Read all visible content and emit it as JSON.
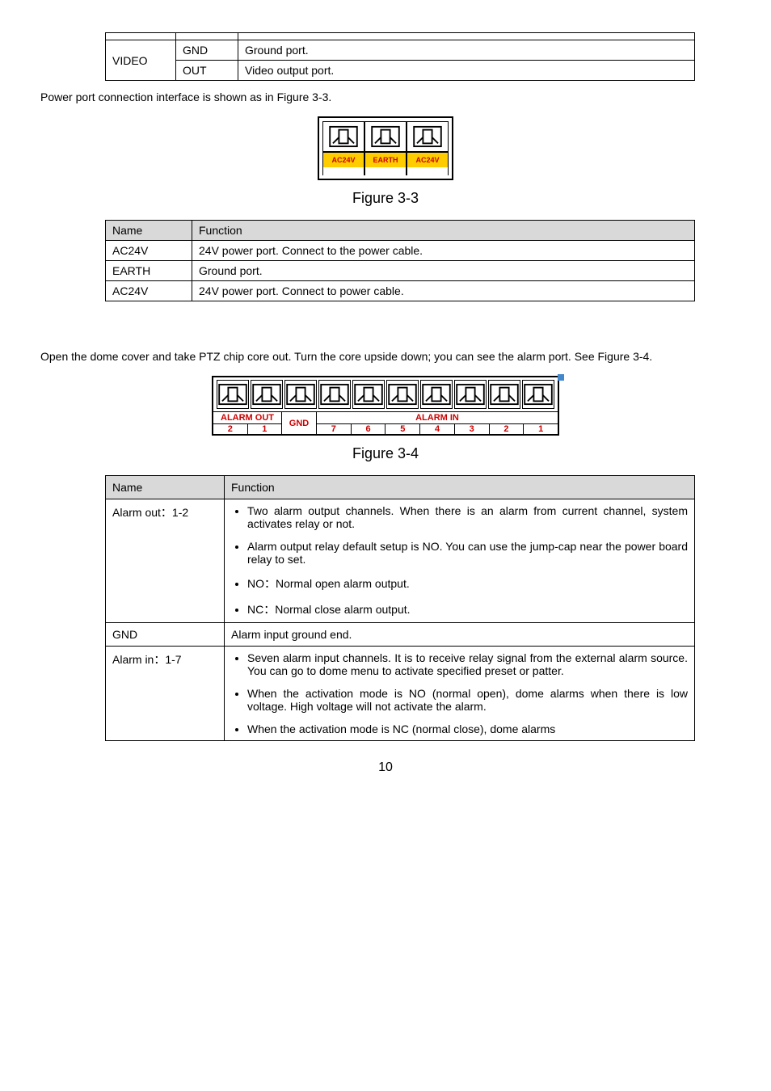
{
  "port_table": {
    "rows": [
      {
        "c1": "VIDEO",
        "c2": "GND",
        "c3": "Ground port."
      },
      {
        "c1": "",
        "c2": "OUT",
        "c3": "Video output port."
      }
    ]
  },
  "text_power_intro": "Power port connection interface is shown as in Figure 3-3.",
  "power_labels": [
    "AC24V",
    "EARTH",
    "AC24V"
  ],
  "figure_3_3": "Figure 3-3",
  "func_table_1": {
    "header": {
      "name": "Name",
      "func": "Function"
    },
    "rows": [
      {
        "name": "AC24V",
        "func": "24V power port. Connect to the power cable."
      },
      {
        "name": "EARTH",
        "func": "Ground port."
      },
      {
        "name": "AC24V",
        "func": "24V power port. Connect to power cable."
      }
    ]
  },
  "text_open_dome": "Open the dome cover and take PTZ chip core out. Turn the core upside down; you can see the alarm port. See Figure 3-4.",
  "alarm": {
    "out_label": "ALARM OUT",
    "out_nums": [
      "2",
      "1"
    ],
    "gnd": "GND",
    "in_label": "ALARM IN",
    "in_nums": [
      "7",
      "6",
      "5",
      "4",
      "3",
      "2",
      "1"
    ]
  },
  "figure_3_4": "Figure 3-4",
  "func_table_2": {
    "header": {
      "name": "Name",
      "func": "Function"
    },
    "rows": {
      "alarm_out": {
        "name": "Alarm out：1-2",
        "bullets": [
          "Two alarm output channels. When there is an alarm from current channel, system activates relay or not.",
          "Alarm output relay default setup is NO. You can use the jump-cap near the power board relay to set.",
          "NO：Normal open alarm output.",
          "NC：Normal close alarm output."
        ]
      },
      "gnd": {
        "name": "GND",
        "func": "Alarm input ground end."
      },
      "alarm_in": {
        "name": "Alarm in：1-7",
        "bullets": [
          "Seven alarm input channels. It is to receive relay signal from the external alarm source.  You can go to dome menu to activate specified preset or patter.",
          "When the activation mode is NO (normal open), dome alarms when there is low voltage. High voltage will not activate the alarm.",
          "When the activation mode is NC (normal close), dome alarms"
        ]
      }
    }
  },
  "page_number": "10"
}
